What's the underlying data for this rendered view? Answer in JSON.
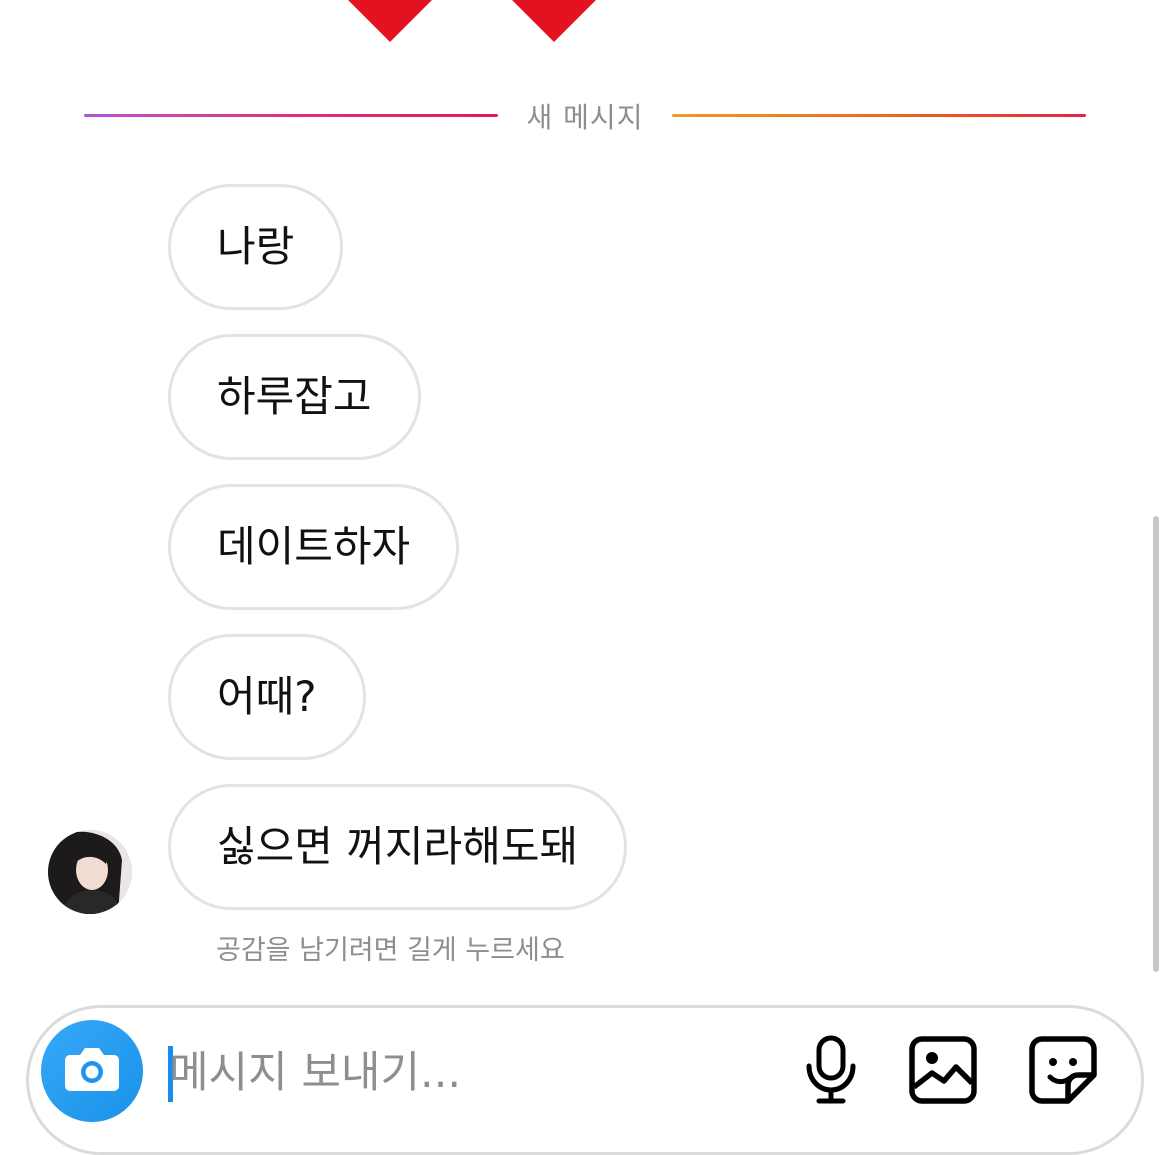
{
  "divider": {
    "label": "새 메시지"
  },
  "messages": [
    {
      "text": "나랑"
    },
    {
      "text": "하루잡고"
    },
    {
      "text": "데이트하자"
    },
    {
      "text": "어때?"
    },
    {
      "text": "싫으면 꺼지라해도돼"
    }
  ],
  "hint": "공감을 남기려면 길게 누르세요",
  "composer": {
    "placeholder": "메시지 보내기..."
  },
  "colors": {
    "accent": "#1992ea",
    "bubble_border": "#e3e3e3",
    "heart": "#e3121f"
  },
  "icons": [
    "heart-icon",
    "camera-icon",
    "microphone-icon",
    "gallery-icon",
    "sticker-icon"
  ]
}
